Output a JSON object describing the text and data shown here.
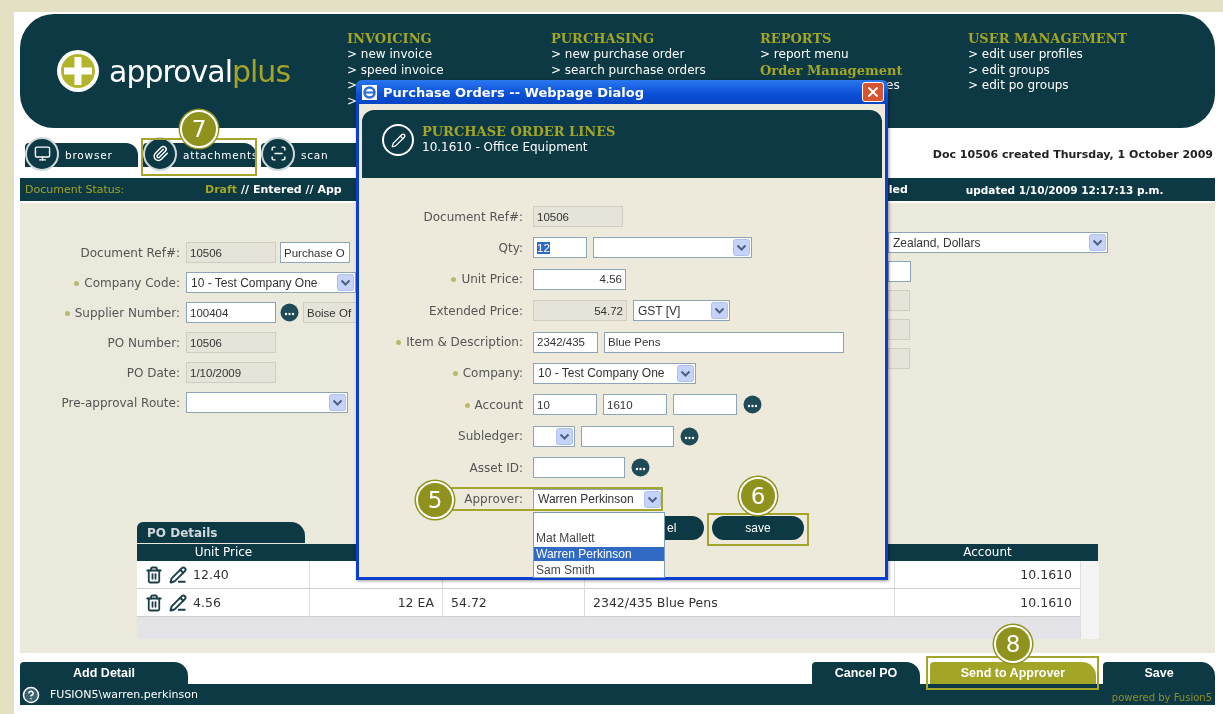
{
  "logo": {
    "word1": "approval",
    "word2": "plus"
  },
  "menu": [
    {
      "title": "INVOICING",
      "items": [
        {
          "text": "> new invoice",
          "kind": "link"
        },
        {
          "text": "> speed invoice",
          "kind": "link"
        },
        {
          "text": ">",
          "kind": "link"
        },
        {
          "text": ">",
          "kind": "link"
        }
      ]
    },
    {
      "title": "PURCHASING",
      "items": [
        {
          "text": "> new purchase order",
          "kind": "link"
        },
        {
          "text": "> search purchase orders",
          "kind": "link"
        }
      ]
    },
    {
      "title": "REPORTS",
      "items": [
        {
          "text": "> report menu",
          "kind": "link"
        },
        {
          "text": "Order Management",
          "kind": "heading"
        },
        {
          "text": "es",
          "kind": "tail"
        }
      ]
    },
    {
      "title": "USER MANAGEMENT",
      "items": [
        {
          "text": "> edit user profiles",
          "kind": "link"
        },
        {
          "text": "> edit groups",
          "kind": "link"
        },
        {
          "text": "> edit po groups",
          "kind": "link"
        }
      ]
    }
  ],
  "toolbar": [
    {
      "label": "browser",
      "kind": "browser"
    },
    {
      "label": "attachments",
      "kind": "attachments"
    },
    {
      "label": "scan",
      "kind": "scan"
    }
  ],
  "doc_info": "Doc 10506 created Thursday, 1 October 2009",
  "status": {
    "label": "Document Status:",
    "current": "Draft",
    "trail": "// Entered // App",
    "tail": "led",
    "updated": "updated 1/10/2009 12:17:13 p.m."
  },
  "form": [
    {
      "label": "Document Ref#:",
      "required": false,
      "controls": [
        {
          "kind": "input",
          "value": "10506",
          "readonly": true
        },
        {
          "kind": "input",
          "value": "Purchase O",
          "readonly": false
        }
      ]
    },
    {
      "label": "Company Code:",
      "required": true,
      "controls": [
        {
          "kind": "select",
          "value": "10 - Test Company One"
        }
      ]
    },
    {
      "label": "Supplier Number:",
      "required": true,
      "controls": [
        {
          "kind": "input",
          "value": "100404",
          "readonly": false
        },
        {
          "kind": "lookup"
        },
        {
          "kind": "input",
          "value": "Boise Of",
          "readonly": true
        }
      ]
    },
    {
      "label": "PO Number:",
      "required": false,
      "controls": [
        {
          "kind": "input",
          "value": "10506",
          "readonly": true
        }
      ]
    },
    {
      "label": "PO Date:",
      "required": false,
      "controls": [
        {
          "kind": "input",
          "value": "1/10/2009",
          "readonly": true
        }
      ]
    },
    {
      "label": "Pre-approval Route:",
      "required": false,
      "controls": [
        {
          "kind": "select"
        }
      ]
    }
  ],
  "side_fields": [
    {
      "kind": "select",
      "value": "Zealand, Dollars"
    },
    {
      "kind": "input",
      "readonly": false
    },
    {
      "kind": "input",
      "readonly": true
    },
    {
      "kind": "input",
      "readonly": true
    },
    {
      "kind": "input",
      "readonly": true
    }
  ],
  "po_details": {
    "title": "PO Details",
    "header": {
      "unit_price": "Unit Price",
      "account": "Account"
    },
    "rows": [
      {
        "unit_price": "12.40",
        "account": "10.1610"
      },
      {
        "unit_price": "4.56",
        "column_2": "12 EA",
        "column_3": "54.72",
        "column_4": "2342/435 Blue Pens",
        "account": "10.1610"
      }
    ]
  },
  "add_detail": "Add Detail",
  "actions": [
    {
      "label": "Cancel PO",
      "primary": false
    },
    {
      "label": "Send to Approver",
      "primary": true
    },
    {
      "label": "Save",
      "primary": false
    }
  ],
  "footer": {
    "user": "FUSION5\\warren.perkinson",
    "powered": "powered by Fusion5"
  },
  "dialog": {
    "title": "Purchase Orders -- Webpage Dialog",
    "heading": "PURCHASE ORDER LINES",
    "subheading": "10.1610 - Office Equipment",
    "rows": [
      {
        "label": "Document Ref#:",
        "required": false,
        "controls": [
          {
            "kind": "input",
            "value": "10506",
            "readonly": true
          }
        ]
      },
      {
        "label": "Qty:",
        "required": false,
        "controls": [
          {
            "kind": "input",
            "value": "12",
            "highlighted": true
          },
          {
            "kind": "select"
          }
        ]
      },
      {
        "label": "Unit Price:",
        "required": true,
        "controls": [
          {
            "kind": "number",
            "value": "4.56"
          }
        ]
      },
      {
        "label": "Extended Price:",
        "required": false,
        "controls": [
          {
            "kind": "number",
            "value": "54.72",
            "readonly": true
          },
          {
            "kind": "select",
            "value": "GST [V]"
          }
        ]
      },
      {
        "label": "Item & Description:",
        "required": true,
        "controls": [
          {
            "kind": "input",
            "value": "2342/435"
          },
          {
            "kind": "input",
            "value": "Blue Pens"
          }
        ]
      },
      {
        "label": "Company:",
        "required": true,
        "controls": [
          {
            "kind": "select",
            "value": "10 - Test Company One"
          }
        ]
      },
      {
        "label": "Account",
        "required": true,
        "controls": [
          {
            "kind": "input",
            "value": "10"
          },
          {
            "kind": "input",
            "value": "1610"
          },
          {
            "kind": "input"
          },
          {
            "kind": "lookup"
          }
        ]
      },
      {
        "label": "Subledger:",
        "required": false,
        "controls": [
          {
            "kind": "select"
          },
          {
            "kind": "input"
          },
          {
            "kind": "lookup"
          }
        ]
      },
      {
        "label": "Asset ID:",
        "required": false,
        "controls": [
          {
            "kind": "input"
          },
          {
            "kind": "lookup"
          }
        ]
      },
      {
        "label": "Approver:",
        "required": false,
        "controls": [
          {
            "kind": "select",
            "value": "Warren Perkinson"
          }
        ]
      }
    ],
    "options": [
      {
        "kind": "name",
        "text": "Mat Mallett",
        "selected": false
      },
      {
        "kind": "name",
        "text": "Warren Perkinson",
        "selected": true
      },
      {
        "kind": "name",
        "text": "Sam Smith",
        "selected": false
      }
    ],
    "buttons": [
      {
        "label": "el",
        "kind": "cut"
      },
      {
        "label": "save",
        "kind": "primary"
      }
    ]
  },
  "callouts": [
    {
      "number": "7"
    },
    {
      "number": "5"
    },
    {
      "number": "6"
    },
    {
      "number": "8"
    }
  ]
}
